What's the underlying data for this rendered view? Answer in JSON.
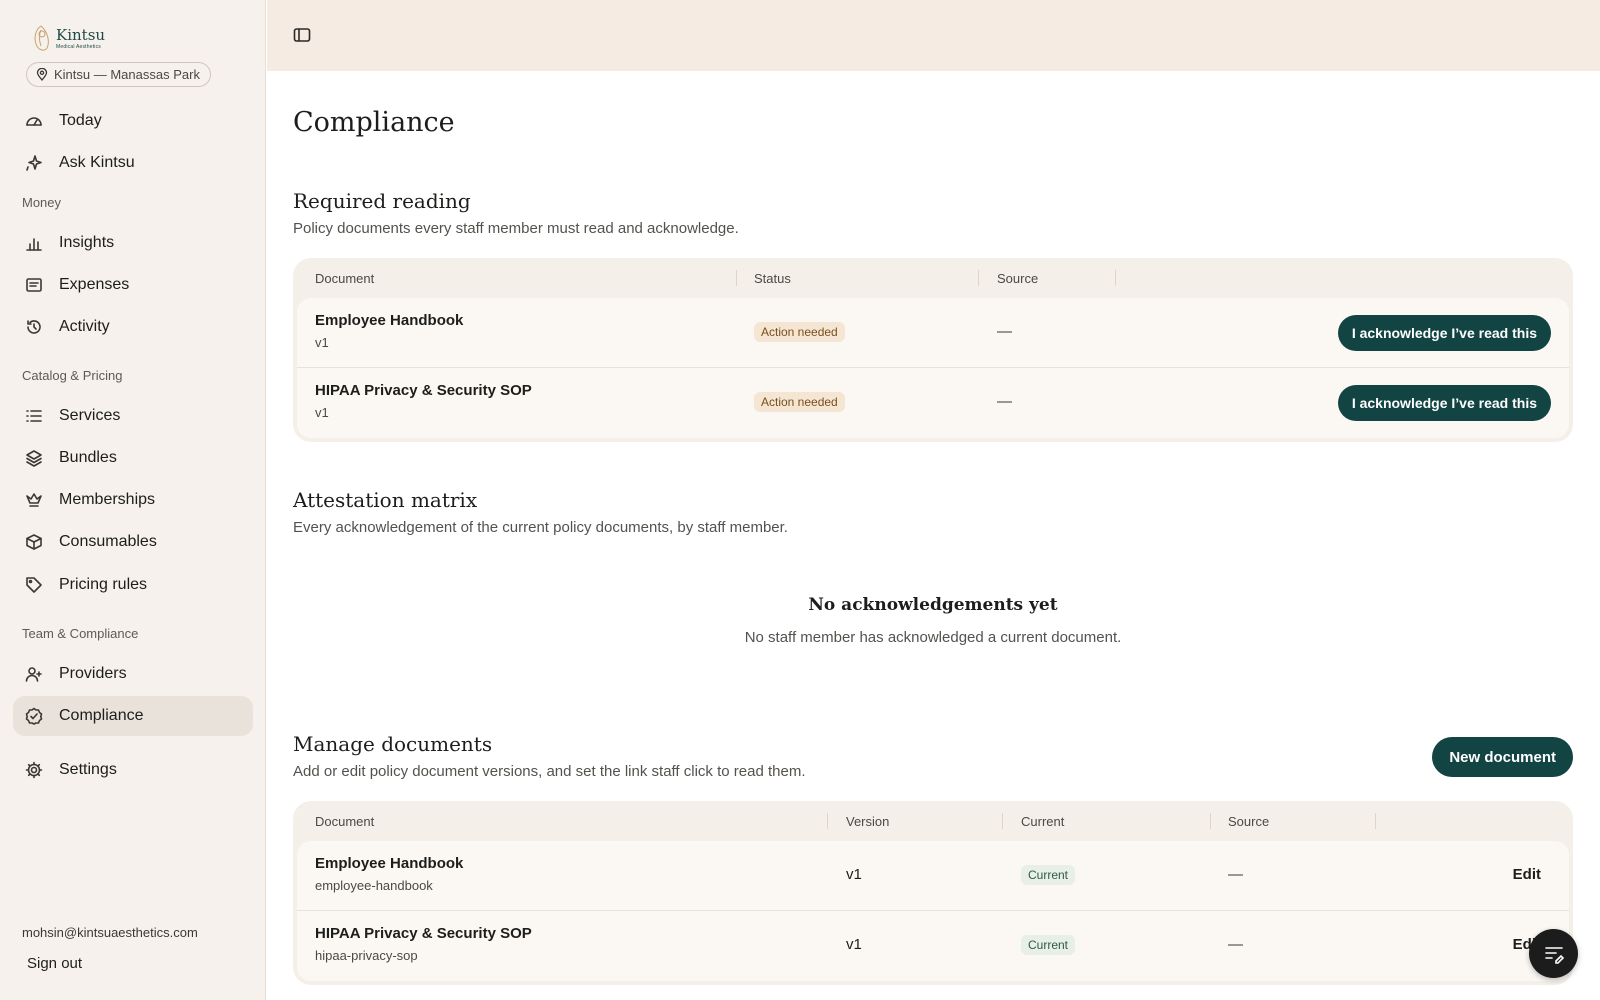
{
  "brand": {
    "name": "Kintsu",
    "tagline": "Medical Aesthetics"
  },
  "location": {
    "label": "Kintsu — Manassas Park"
  },
  "sidebar": {
    "today": "Today",
    "ask": "Ask Kintsu",
    "section_money": "Money",
    "insights": "Insights",
    "expenses": "Expenses",
    "activity": "Activity",
    "section_catalog": "Catalog & Pricing",
    "services": "Services",
    "bundles": "Bundles",
    "memberships": "Memberships",
    "consumables": "Consumables",
    "pricing_rules": "Pricing rules",
    "section_team": "Team & Compliance",
    "providers": "Providers",
    "compliance": "Compliance",
    "settings": "Settings",
    "active_item": "Compliance"
  },
  "user": {
    "email": "mohsin@kintsuaesthetics.com",
    "sign_out": "Sign out"
  },
  "page": {
    "title": "Compliance"
  },
  "required_reading": {
    "title": "Required reading",
    "description": "Policy documents every staff member must read and acknowledge.",
    "columns": {
      "document": "Document",
      "status": "Status",
      "source": "Source"
    },
    "rows": [
      {
        "name": "Employee Handbook",
        "version": "v1",
        "status": "Action needed",
        "source": "—",
        "action": "I acknowledge I’ve read this"
      },
      {
        "name": "HIPAA Privacy & Security SOP",
        "version": "v1",
        "status": "Action needed",
        "source": "—",
        "action": "I acknowledge I’ve read this"
      }
    ]
  },
  "attestation": {
    "title": "Attestation matrix",
    "description": "Every acknowledgement of the current policy documents, by staff member.",
    "empty_title": "No acknowledgements yet",
    "empty_description": "No staff member has acknowledged a current document."
  },
  "manage": {
    "title": "Manage documents",
    "description": "Add or edit policy document versions, and set the link staff click to read them.",
    "new_button": "New document",
    "columns": {
      "document": "Document",
      "version": "Version",
      "current": "Current",
      "source": "Source"
    },
    "rows": [
      {
        "name": "Employee Handbook",
        "slug": "employee-handbook",
        "version": "v1",
        "current": "Current",
        "source": "—",
        "action": "Edit"
      },
      {
        "name": "HIPAA Privacy & Security SOP",
        "slug": "hipaa-privacy-sop",
        "version": "v1",
        "current": "Current",
        "source": "—",
        "action": "Edit"
      }
    ]
  },
  "icons": {
    "logo": "kintsu-logo-icon",
    "location": "map-pin-icon",
    "panel_toggle": "sidebar-panel-icon",
    "fab": "edit-list-icon"
  },
  "colors": {
    "accent": "#114442",
    "sidebar_bg": "#f6f1ec",
    "topbar_bg": "#f5ebe2",
    "warn_badge": "#f5e6d4",
    "ok_badge": "#e8efe6"
  }
}
